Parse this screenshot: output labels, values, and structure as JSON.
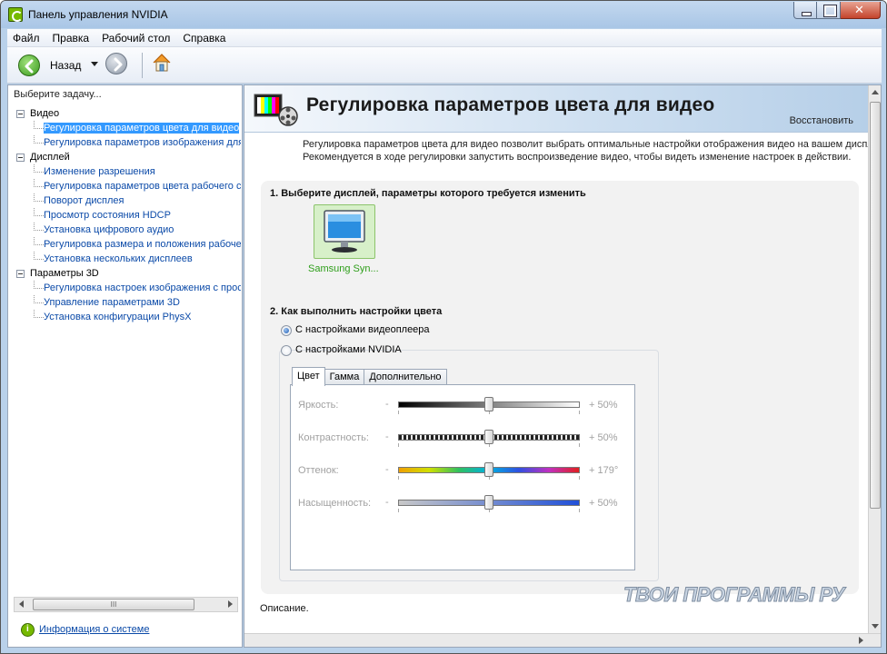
{
  "window": {
    "title": "Панель управления NVIDIA"
  },
  "menu": [
    "Файл",
    "Правка",
    "Рабочий стол",
    "Справка"
  ],
  "toolbar": {
    "back_label": "Назад"
  },
  "left": {
    "task_label": "Выберите задачу...",
    "tree": [
      {
        "type": "cat",
        "label": "Видео"
      },
      {
        "type": "item",
        "label": "Регулировка параметров цвета для видео",
        "selected": true
      },
      {
        "type": "item",
        "label": "Регулировка параметров изображения для видео"
      },
      {
        "type": "cat",
        "label": "Дисплей"
      },
      {
        "type": "item",
        "label": "Изменение разрешения"
      },
      {
        "type": "item",
        "label": "Регулировка параметров цвета рабочего стола"
      },
      {
        "type": "item",
        "label": "Поворот дисплея"
      },
      {
        "type": "item",
        "label": "Просмотр состояния HDCP"
      },
      {
        "type": "item",
        "label": "Установка цифрового аудио"
      },
      {
        "type": "item",
        "label": "Регулировка размера и положения рабочего стола"
      },
      {
        "type": "item",
        "label": "Установка нескольких дисплеев"
      },
      {
        "type": "cat",
        "label": "Параметры 3D"
      },
      {
        "type": "item",
        "label": "Регулировка настроек изображения с просмотром"
      },
      {
        "type": "item",
        "label": "Управление параметрами 3D"
      },
      {
        "type": "item",
        "label": "Установка конфигурации PhysX"
      }
    ],
    "scroll_grip": "III",
    "system_info": "Информация о системе"
  },
  "main": {
    "title": "Регулировка параметров цвета для видео",
    "restore": "Восстановить",
    "desc_line1": "Регулировка параметров цвета для видео позволит выбрать оптимальные настройки отображения видео на вашем дисплее.",
    "desc_line2": "Рекомендуется в ходе регулировки запустить воспроизведение видео, чтобы видеть изменение настроек в действии.",
    "step1": "1. Выберите дисплей, параметры которого требуется изменить",
    "display_name": "Samsung Syn...",
    "step2": "2. Как выполнить настройки цвета",
    "radio1": "С настройками видеоплеера",
    "radio2": "С настройками NVIDIA",
    "tabs": [
      "Цвет",
      "Гамма",
      "Дополнительно"
    ],
    "sliders": [
      {
        "name": "Яркость:",
        "minus": "-",
        "value_text": "+ 50%",
        "level": 0.5
      },
      {
        "name": "Контрастность:",
        "minus": "-",
        "value_text": "+ 50%",
        "level": 0.5
      },
      {
        "name": "Оттенок:",
        "minus": "-",
        "value_text": "+ 179°",
        "level": 0.5
      },
      {
        "name": "Насыщенность:",
        "minus": "-",
        "value_text": "+ 50%",
        "level": 0.5
      }
    ],
    "description_label": "Описание.",
    "watermark": "ТВОИ ПРОГРАММЫ РУ"
  },
  "colors": {
    "nvidia_green": "#76b900",
    "link_blue": "#0b4aa8",
    "selection": "#3399ff"
  }
}
